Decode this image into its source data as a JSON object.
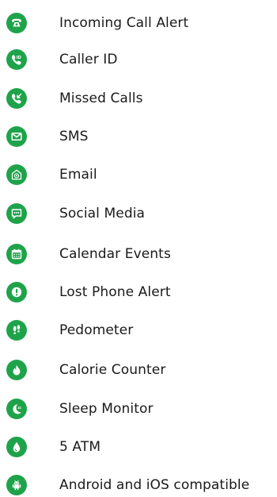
{
  "theme": {
    "accent": "#1fa34a",
    "text": "#1a1a1a",
    "background": "#ffffff"
  },
  "features": [
    {
      "label": "Incoming Call Alert",
      "icon": "phone-icon"
    },
    {
      "label": "Caller ID",
      "icon": "caller-id-icon"
    },
    {
      "label": "Missed Calls",
      "icon": "missed-call-icon"
    },
    {
      "label": "SMS",
      "icon": "envelope-icon"
    },
    {
      "label": "Email",
      "icon": "email-at-icon"
    },
    {
      "label": "Social Media",
      "icon": "chat-bubble-icon"
    },
    {
      "label": "Calendar Events",
      "icon": "calendar-icon"
    },
    {
      "label": "Lost Phone Alert",
      "icon": "alert-exclamation-icon"
    },
    {
      "label": "Pedometer",
      "icon": "footprints-icon"
    },
    {
      "label": "Calorie Counter",
      "icon": "flame-icon"
    },
    {
      "label": "Sleep Monitor",
      "icon": "moon-sleep-icon"
    },
    {
      "label": "5 ATM",
      "icon": "water-drop-icon"
    },
    {
      "label": "Android and iOS compatible",
      "icon": "android-icon"
    }
  ]
}
